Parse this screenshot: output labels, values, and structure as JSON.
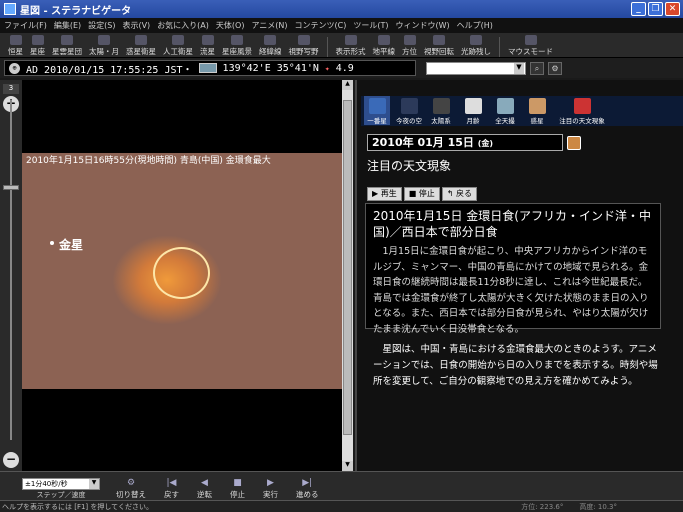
{
  "window": {
    "title": "星図 - ステラナビゲータ",
    "min": "_",
    "max": "❐",
    "close": "✕"
  },
  "menu": [
    "ファイル(F)",
    "編集(E)",
    "設定(S)",
    "表示(V)",
    "お気に入り(A)",
    "天体(O)",
    "アニメ(N)",
    "コンテンツ(C)",
    "ツール(T)",
    "ウィンドウ(W)",
    "ヘルプ(H)"
  ],
  "toolbar": [
    "恒星",
    "星座",
    "星雲星団",
    "太陽・月",
    "惑星衛星",
    "人工衛星",
    "流星",
    "星座風景",
    "経緯線",
    "視野写野",
    "表示形式",
    "地平線",
    "方位",
    "視野回転",
    "光跡残し",
    "マウスモード"
  ],
  "infobar": {
    "badge": "⊕",
    "text": "AD 2010/01/15 17:55:25 JST・",
    "coords": "139°42'E 35°41'N",
    "mag": "4.9"
  },
  "leftstrip": {
    "zoom_level": "3",
    "zoom_in": "+",
    "zoom_out": "−"
  },
  "sky": {
    "caption": "2010年1月15日16時55分(現地時間) 青島(中国) 金環食最大",
    "venus_label": "金星"
  },
  "panel": {
    "nav": [
      {
        "label": "一番星",
        "color": "#3a6ab8"
      },
      {
        "label": "今夜の空",
        "color": "#2c3a5a"
      },
      {
        "label": "太陽系",
        "color": "#444"
      },
      {
        "label": "月齢",
        "color": "#ddd"
      },
      {
        "label": "全天撮",
        "color": "#8ab"
      },
      {
        "label": "惑星",
        "color": "#c96"
      },
      {
        "label": "注目の天文現象",
        "color": "#c33"
      }
    ],
    "date": "2010年 01月 15日",
    "date_dow": "(金)",
    "heading": "注目の天文現象",
    "controls": [
      "▶ 再生",
      "■ 停止",
      "↰ 戻る"
    ],
    "event_title": "2010年1月15日 金環日食(アフリカ・インド洋・中国)／西日本で部分日食",
    "event_body": "1月15日に金環日食が起こり、中央アフリカからインド洋のモルジブ、ミャンマー、中国の青島にかけての地域で見られる。金環日食の継続時間は最長11分8秒に達し、これは今世紀最長だ。青島では金環食が終了し太陽が大きく欠けた状態のまま日の入りとなる。また、西日本では部分日食が見られ、やはり太陽が欠けたまま沈んでいく日没帯食となる。",
    "note": "星図は、中国・青島における金環食最大のときのようす。アニメーションでは、日食の開始から日の入りまでを表示する。時刻や場所を変更して、ご自分の観察地での見え方を確かめてみよう。"
  },
  "bottom": {
    "speed_value": "±1分40秒/秒",
    "speed_label": "ステップ／速度",
    "buttons": [
      {
        "icon": "⚙",
        "label": "切り替え"
      },
      {
        "icon": "|◀",
        "label": "戻す"
      },
      {
        "icon": "◀",
        "label": "逆転"
      },
      {
        "icon": "■",
        "label": "停止"
      },
      {
        "icon": "▶",
        "label": "実行"
      },
      {
        "icon": "▶|",
        "label": "進める"
      }
    ]
  },
  "status": {
    "help": "ヘルプを表示するには [F1] を押してください。",
    "azimuth": "方位: 223.6°",
    "altitude": "高度: 10.3°"
  }
}
